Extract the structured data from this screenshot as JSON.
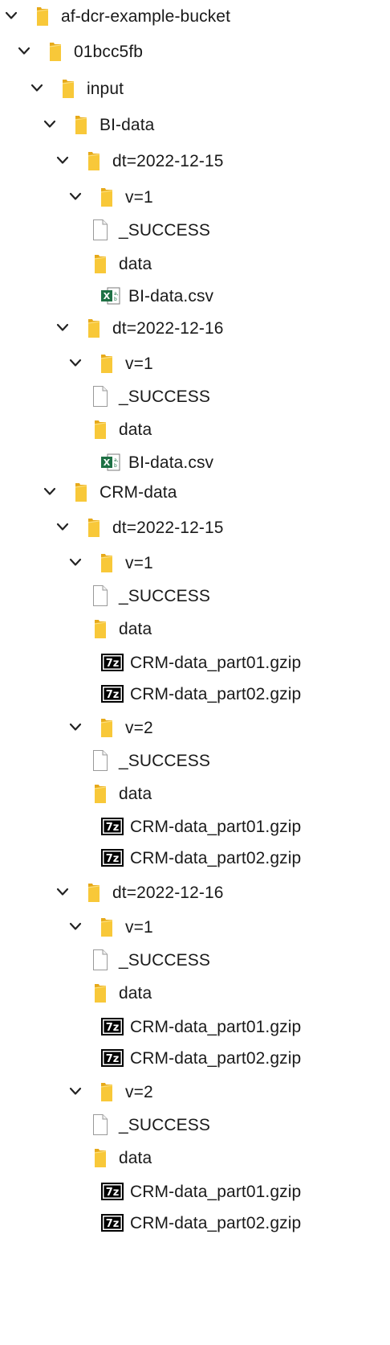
{
  "tree": [
    {
      "label": "af-dcr-example-bucket",
      "icon": "folder-icon",
      "expanded": true,
      "depth": 0
    },
    {
      "label": "01bcc5fb",
      "icon": "folder-icon",
      "expanded": true,
      "depth": 1
    },
    {
      "label": "input",
      "icon": "folder-icon",
      "expanded": true,
      "depth": 2
    },
    {
      "label": "BI-data",
      "icon": "folder-icon",
      "expanded": true,
      "depth": 3
    },
    {
      "label": "dt=2022-12-15",
      "icon": "folder-icon",
      "expanded": true,
      "depth": 4
    },
    {
      "label": "v=1",
      "icon": "folder-icon",
      "expanded": true,
      "depth": 5
    },
    {
      "label": "_SUCCESS",
      "icon": "file-icon",
      "expanded": false,
      "depth": 6
    },
    {
      "label": "data",
      "icon": "folder-icon",
      "expanded": false,
      "depth": 6
    },
    {
      "label": "BI-data.csv",
      "icon": "excel-csv-icon",
      "expanded": false,
      "depth": 7
    },
    {
      "label": "dt=2022-12-16",
      "icon": "folder-icon",
      "expanded": true,
      "depth": 4
    },
    {
      "label": "v=1",
      "icon": "folder-icon",
      "expanded": true,
      "depth": 5
    },
    {
      "label": "_SUCCESS",
      "icon": "file-icon",
      "expanded": false,
      "depth": 6
    },
    {
      "label": "data",
      "icon": "folder-icon",
      "expanded": false,
      "depth": 6
    },
    {
      "label": "BI-data.csv",
      "icon": "excel-csv-icon",
      "expanded": false,
      "depth": 7
    },
    {
      "label": "CRM-data",
      "icon": "folder-icon",
      "expanded": true,
      "depth": 3
    },
    {
      "label": "dt=2022-12-15",
      "icon": "folder-icon",
      "expanded": true,
      "depth": 4
    },
    {
      "label": "v=1",
      "icon": "folder-icon",
      "expanded": true,
      "depth": 5
    },
    {
      "label": "_SUCCESS",
      "icon": "file-icon",
      "expanded": false,
      "depth": 6
    },
    {
      "label": "data",
      "icon": "folder-icon",
      "expanded": false,
      "depth": 6
    },
    {
      "label": "CRM-data_part01.gzip",
      "icon": "7zip-archive-icon",
      "expanded": false,
      "depth": 7
    },
    {
      "label": "CRM-data_part02.gzip",
      "icon": "7zip-archive-icon",
      "expanded": false,
      "depth": 7
    },
    {
      "label": "v=2",
      "icon": "folder-icon",
      "expanded": true,
      "depth": 5
    },
    {
      "label": "_SUCCESS",
      "icon": "file-icon",
      "expanded": false,
      "depth": 6
    },
    {
      "label": "data",
      "icon": "folder-icon",
      "expanded": false,
      "depth": 6
    },
    {
      "label": "CRM-data_part01.gzip",
      "icon": "7zip-archive-icon",
      "expanded": false,
      "depth": 7
    },
    {
      "label": "CRM-data_part02.gzip",
      "icon": "7zip-archive-icon",
      "expanded": false,
      "depth": 7
    },
    {
      "label": "dt=2022-12-16",
      "icon": "folder-icon",
      "expanded": true,
      "depth": 4
    },
    {
      "label": "v=1",
      "icon": "folder-icon",
      "expanded": true,
      "depth": 5
    },
    {
      "label": "_SUCCESS",
      "icon": "file-icon",
      "expanded": false,
      "depth": 6
    },
    {
      "label": "data",
      "icon": "folder-icon",
      "expanded": false,
      "depth": 6
    },
    {
      "label": "CRM-data_part01.gzip",
      "icon": "7zip-archive-icon",
      "expanded": false,
      "depth": 7
    },
    {
      "label": "CRM-data_part02.gzip",
      "icon": "7zip-archive-icon",
      "expanded": false,
      "depth": 7
    },
    {
      "label": "v=2",
      "icon": "folder-icon",
      "expanded": true,
      "depth": 5
    },
    {
      "label": "_SUCCESS",
      "icon": "file-icon",
      "expanded": false,
      "depth": 6
    },
    {
      "label": "data",
      "icon": "folder-icon",
      "expanded": false,
      "depth": 6
    },
    {
      "label": "CRM-data_part01.gzip",
      "icon": "7zip-archive-icon",
      "expanded": false,
      "depth": 7
    },
    {
      "label": "CRM-data_part02.gzip",
      "icon": "7zip-archive-icon",
      "expanded": false,
      "depth": 7
    }
  ],
  "colors": {
    "folder": "#f8c839",
    "folder_shade": "#e6a91a",
    "excel_green": "#1e7145",
    "chevron": "#222222"
  }
}
